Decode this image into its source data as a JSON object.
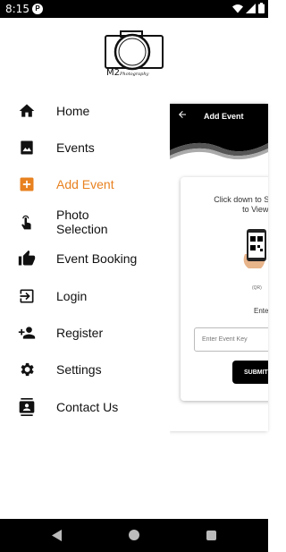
{
  "status_bar": {
    "time": "8:15",
    "notification_badge": "P"
  },
  "brand": {
    "logo_primary": "M2",
    "logo_secondary": "Photography"
  },
  "menu": {
    "items": [
      {
        "label": "Home",
        "icon": "home-icon",
        "active": false
      },
      {
        "label": "Events",
        "icon": "image-icon",
        "active": false
      },
      {
        "label": "Add Event",
        "icon": "add-box-icon",
        "active": true
      },
      {
        "label": "Photo Selection",
        "icon": "touch-icon",
        "active": false
      },
      {
        "label": "Event Booking",
        "icon": "thumb-up-icon",
        "active": false
      },
      {
        "label": "Login",
        "icon": "login-icon",
        "active": false
      },
      {
        "label": "Register",
        "icon": "person-add-icon",
        "active": false
      },
      {
        "label": "Settings",
        "icon": "gear-icon",
        "active": false
      },
      {
        "label": "Contact Us",
        "icon": "contacts-icon",
        "active": false
      }
    ]
  },
  "background_screen": {
    "title": "Add Event",
    "instruction_line1": "Click down to Sca",
    "instruction_line2": "to View E",
    "qr_caption": "(QR)",
    "enter_label": "Enter Event",
    "input_placeholder": "Enter Event Key",
    "submit_label": "SUBMIT"
  },
  "colors": {
    "accent": "#e8811f",
    "text": "#111111",
    "status_bar": "#000000"
  }
}
